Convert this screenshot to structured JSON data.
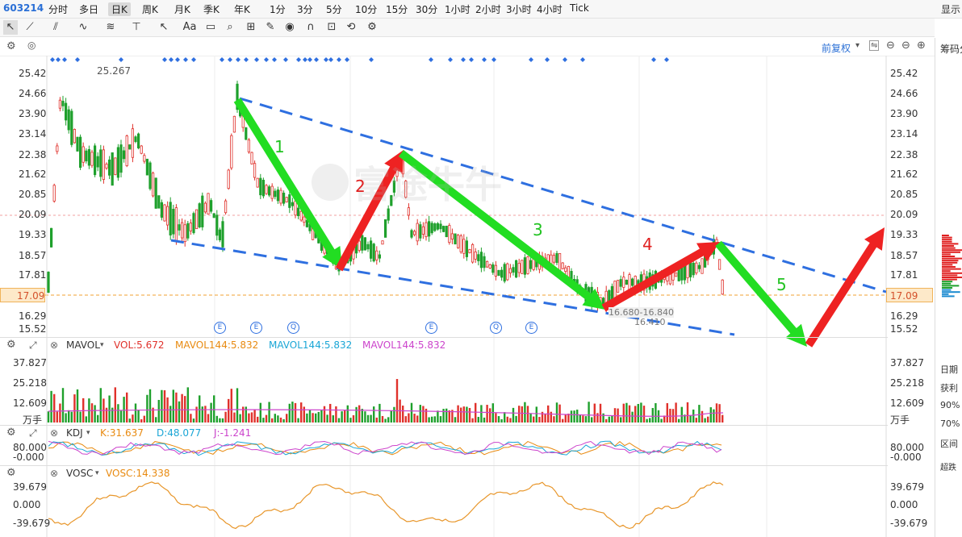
{
  "stock": {
    "code": "603214"
  },
  "periods": [
    "分时",
    "多日",
    "日K",
    "周K",
    "月K",
    "季K",
    "年K",
    "1分",
    "3分",
    "5分",
    "10分",
    "15分",
    "30分",
    "1小时",
    "2小时",
    "3小时",
    "4小时",
    "Tick"
  ],
  "active_period": "日K",
  "corner_label": "显示",
  "toolbar_icons": [
    "cursor-icon",
    "line-tool-icon",
    "channel-tool-icon",
    "wave-tool-icon",
    "fib-tool-icon",
    "hline-tool-icon",
    "arrow-tool-icon",
    "text-tool-icon",
    "comment-icon",
    "zoom-icon",
    "measure-icon",
    "pen-icon",
    "eye-icon",
    "magnet-icon",
    "trash-icon",
    "sync-icon",
    "settings-icon"
  ],
  "main_chart": {
    "adjust_label": "前复权",
    "axis_ticks": [
      "25.42",
      "24.66",
      "23.90",
      "23.14",
      "22.38",
      "21.62",
      "20.85",
      "20.09",
      "19.33",
      "18.57",
      "17.81",
      "17.09",
      "16.29",
      "15.52"
    ],
    "last_price": "17.09",
    "high_label": "25.267",
    "low_label_range": "16.680-16.840",
    "low_label": "16.410",
    "event_markers": [
      "E",
      "E",
      "Q",
      "E",
      "Q",
      "E"
    ],
    "watermark": "富途牛牛",
    "wave_labels": [
      "1",
      "2",
      "3",
      "4",
      "5"
    ],
    "colors": {
      "up": "#e0312b",
      "down": "#1fa02c",
      "channel": "#2e6fe0",
      "arrow_down": "#22dd22",
      "arrow_up": "#ee2222"
    }
  },
  "volume_panel": {
    "title": "MAVOL",
    "vol": "VOL:5.672",
    "ma1": "MAVOL144:5.832",
    "ma2": "MAVOL144:5.832",
    "ma3": "MAVOL144:5.832",
    "axis_ticks": [
      "37.827",
      "25.218",
      "12.609"
    ],
    "unit": "万手"
  },
  "kdj_panel": {
    "title": "KDJ",
    "k": "K:31.637",
    "d": "D:48.077",
    "j": "J:-1.241",
    "axis_ticks": [
      "80.000",
      "-0.000"
    ]
  },
  "vosc_panel": {
    "title": "VOSC",
    "vosc": "VOSC:14.338",
    "axis_ticks": [
      "39.679",
      "0.000",
      "-39.679"
    ]
  },
  "side_panel": {
    "title": "筹码分",
    "items": [
      "日期",
      "获利",
      "90%",
      "70%",
      "区间",
      "超跌"
    ]
  }
}
